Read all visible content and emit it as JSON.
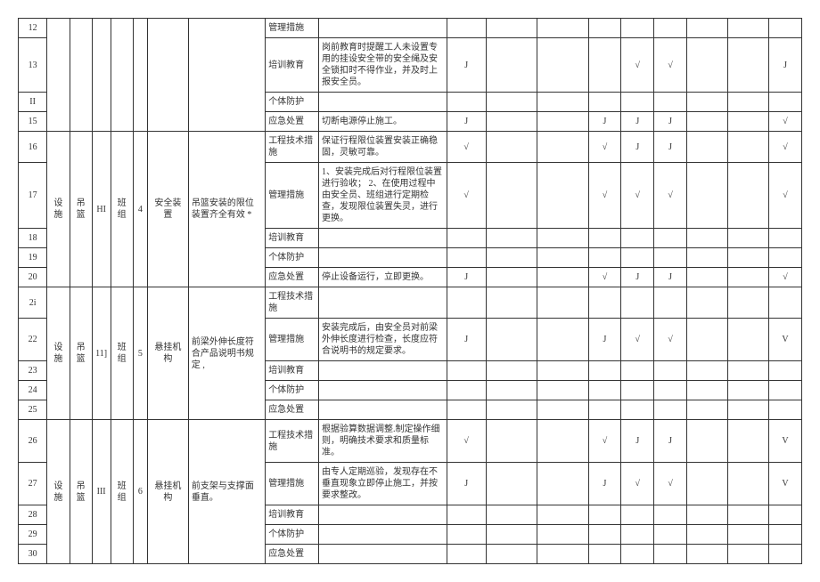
{
  "rows": [
    {
      "num": "12",
      "h": "管理措施",
      "i": "",
      "j": "",
      "k": "",
      "l": "",
      "m": "",
      "n": "",
      "o": "",
      "p": "",
      "q": "",
      "r": ""
    },
    {
      "num": "13",
      "h": "培训教育",
      "i": "岗前教育时提醒工人未设置专用的挂设安全带的安全绳及安全锁扣时不得作业，并及时上报安全员。",
      "j": "J",
      "k": "",
      "l": "",
      "m": "",
      "n": "√",
      "o": "√",
      "p": "",
      "q": "",
      "r": "J"
    },
    {
      "num": "II",
      "h": "个体防护",
      "i": "",
      "j": "",
      "k": "",
      "l": "",
      "m": "",
      "n": "",
      "o": "",
      "p": "",
      "q": "",
      "r": ""
    },
    {
      "num": "15",
      "h": "应急处置",
      "i": "切断电源停止施工。",
      "j": "J",
      "k": "",
      "l": "",
      "m": "J",
      "n": "J",
      "o": "J",
      "p": "",
      "q": "",
      "r": "√"
    },
    {
      "num": "16",
      "a": "设施",
      "b": "吊篮",
      "c": "HI",
      "d": "班组",
      "e": "4",
      "f": "安全装置",
      "g": "吊篮安装的限位装置齐全有效 *",
      "span": 5,
      "h": "工程技术措施",
      "i": "保证行程限位装置安装正确稳固，灵敏可靠。",
      "j": "√",
      "k": "",
      "l": "",
      "m": "√",
      "n": "J",
      "o": "J",
      "p": "",
      "q": "",
      "r": "√"
    },
    {
      "num": "17",
      "h": "管理措施",
      "i": "1、安装完成后对行程限位装置进行验收；\n2、在使用过程中由安全员、班组进行定期检查，发现限位装置失灵，进行更换。",
      "j": "√",
      "k": "",
      "l": "",
      "m": "√",
      "n": "√",
      "o": "√",
      "p": "",
      "q": "",
      "r": "√"
    },
    {
      "num": "18",
      "h": "培训教育",
      "i": "",
      "j": "",
      "k": "",
      "l": "",
      "m": "",
      "n": "",
      "o": "",
      "p": "",
      "q": "",
      "r": ""
    },
    {
      "num": "19",
      "h": "个体防护",
      "i": "",
      "j": "",
      "k": "",
      "l": "",
      "m": "",
      "n": "",
      "o": "",
      "p": "",
      "q": "",
      "r": ""
    },
    {
      "num": "20",
      "h": "应急处置",
      "i": "停止设备运行，立即更换。",
      "j": "J",
      "k": "",
      "l": "",
      "m": "√",
      "n": "J",
      "o": "J",
      "p": "",
      "q": "",
      "r": "√"
    },
    {
      "num": "2i",
      "a": "设施",
      "b": "吊篮",
      "c": "11]",
      "d": "班组",
      "e": "5",
      "f": "悬挂机构",
      "g": "前梁外伸长度符合产品说明书规定 ,",
      "span": 5,
      "h": "工程技术措施",
      "i": "",
      "j": "",
      "k": "",
      "l": "",
      "m": "",
      "n": "",
      "o": "",
      "p": "",
      "q": "",
      "r": ""
    },
    {
      "num": "22",
      "h": "管理措施",
      "i": "安装完成后，由安全员对前梁外伸长度进行检查，长度应符合说明书的规定要求。",
      "j": "J",
      "k": "",
      "l": "",
      "m": "J",
      "n": "√",
      "o": "√",
      "p": "",
      "q": "",
      "r": "V"
    },
    {
      "num": "23",
      "h": "培训教育",
      "i": "",
      "j": "",
      "k": "",
      "l": "",
      "m": "",
      "n": "",
      "o": "",
      "p": "",
      "q": "",
      "r": ""
    },
    {
      "num": "24",
      "h": "个体防护",
      "i": "",
      "j": "",
      "k": "",
      "l": "",
      "m": "",
      "n": "",
      "o": "",
      "p": "",
      "q": "",
      "r": ""
    },
    {
      "num": "25",
      "h": "应急处置",
      "i": "",
      "j": "",
      "k": "",
      "l": "",
      "m": "",
      "n": "",
      "o": "",
      "p": "",
      "q": "",
      "r": ""
    },
    {
      "num": "26",
      "a": "设施",
      "b": "吊篮",
      "c": "III",
      "d": "班组",
      "e": "6",
      "f": "悬挂机构",
      "g": "前支架与支撑面垂直。",
      "span": 5,
      "h": "工程技术措施",
      "i": "根据验算数据调整.制定操作细则，明确技术要求和质量标准。",
      "j": "√",
      "k": "",
      "l": "",
      "m": "√",
      "n": "J",
      "o": "J",
      "p": "",
      "q": "",
      "r": "V"
    },
    {
      "num": "27",
      "h": "管理措施",
      "i": "由专人定期巡验，发现存在不垂直现象立即停止施工，并按要求整改。",
      "j": "J",
      "k": "",
      "l": "",
      "m": "J",
      "n": "√",
      "o": "√",
      "p": "",
      "q": "",
      "r": "V"
    },
    {
      "num": "28",
      "h": "培训教育",
      "i": "",
      "j": "",
      "k": "",
      "l": "",
      "m": "",
      "n": "",
      "o": "",
      "p": "",
      "q": "",
      "r": ""
    },
    {
      "num": "29",
      "h": "个体防护",
      "i": "",
      "j": "",
      "k": "",
      "l": "",
      "m": "",
      "n": "",
      "o": "",
      "p": "",
      "q": "",
      "r": ""
    },
    {
      "num": "30",
      "h": "应急处置",
      "i": "",
      "j": "",
      "k": "",
      "l": "",
      "m": "",
      "n": "",
      "o": "",
      "p": "",
      "q": "",
      "r": ""
    }
  ]
}
